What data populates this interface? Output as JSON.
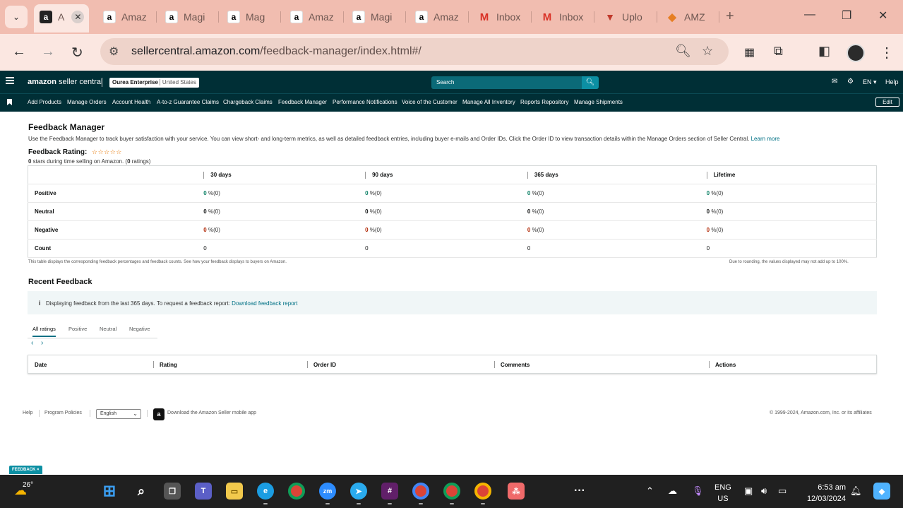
{
  "browser": {
    "tabs": [
      {
        "title": "A",
        "icon": "amazon-icon",
        "active": true
      },
      {
        "title": "Amaz",
        "icon": "amazon-icon"
      },
      {
        "title": "Magi",
        "icon": "amazon-icon"
      },
      {
        "title": "Mag",
        "icon": "amazon-icon"
      },
      {
        "title": "Amaz",
        "icon": "amazon-icon"
      },
      {
        "title": "Magi",
        "icon": "amazon-icon"
      },
      {
        "title": "Amaz",
        "icon": "amazon-icon"
      },
      {
        "title": "Inbox",
        "icon": "gmail-icon"
      },
      {
        "title": "Inbox",
        "icon": "gmail-icon"
      },
      {
        "title": "Uplo",
        "icon": "upload-icon"
      },
      {
        "title": "AMZ",
        "icon": "amz-icon"
      }
    ],
    "url_host": "sellercentral.amazon.com",
    "url_path": "/feedback-manager/index.html#/"
  },
  "header": {
    "logo_bold": "amazon",
    "logo_rest": " seller central",
    "store_name": "Ourea Enterprise",
    "marketplace": "United States",
    "search_placeholder": "Search",
    "lang": "EN",
    "help": "Help"
  },
  "nav": {
    "items": [
      "Add Products",
      "Manage Orders",
      "Account Health",
      "A-to-z Guarantee Claims",
      "Chargeback Claims",
      "Feedback Manager",
      "Performance Notifications",
      "Voice of the Customer",
      "Manage All Inventory",
      "Reports Repository",
      "Manage Shipments"
    ],
    "edit_label": "Edit"
  },
  "page": {
    "title": "Feedback Manager",
    "description": "Use the Feedback Manager to track buyer satisfaction with your service. You can view short- and long-term metrics, as well as detailed feedback entries, including buyer e-mails and Order IDs. Click the Order ID to view transaction details within the Manage Orders section of Seller Central.",
    "learn_more": "Learn more",
    "rating_label": "Feedback Rating:",
    "stars": "☆☆☆☆☆",
    "rating_stars_count": "0",
    "rating_text_mid": " stars during time selling on Amazon. (",
    "rating_count": "0",
    "rating_text_end": " ratings)"
  },
  "feedback_table": {
    "columns": [
      "30 days",
      "90 days",
      "365 days",
      "Lifetime"
    ],
    "pct_suffix": "%(0)",
    "rows": [
      {
        "label": "Positive",
        "values": [
          "0",
          "0",
          "0",
          "0"
        ]
      },
      {
        "label": "Neutral",
        "values": [
          "0",
          "0",
          "0",
          "0"
        ]
      },
      {
        "label": "Negative",
        "values": [
          "0",
          "0",
          "0",
          "0"
        ]
      },
      {
        "label": "Count",
        "values": [
          "0",
          "0",
          "0",
          "0"
        ]
      }
    ],
    "note_left_prefix": "This table displays the corresponding feedback percentages and feedback counts. ",
    "note_left_link": "See how your feedback displays to buyers on Amazon.",
    "note_right": "Due to rounding, the values displayed may not add up to 100%."
  },
  "recent": {
    "title": "Recent Feedback",
    "info_icon": "i",
    "info_text": "Displaying feedback from the last 365 days. To request a feedback report:",
    "info_link": "Download feedback report",
    "tabs": [
      "All ratings",
      "Positive",
      "Neutral",
      "Negative"
    ],
    "columns": [
      "Date",
      "Rating",
      "Order ID",
      "Comments",
      "Actions"
    ]
  },
  "footer": {
    "help": "Help",
    "program_policies": "Program Policies",
    "language": "English",
    "app_text": "Download the Amazon Seller mobile app",
    "copyright": "© 1999-2024, Amazon.com, Inc. or its affiliates",
    "feedback_tag": "FEEDBACK ×"
  },
  "taskbar": {
    "temperature": "26°",
    "lang_line1": "ENG",
    "lang_line2": "US",
    "time": "6:53 am",
    "date": "12/03/2024"
  },
  "colors": {
    "header_bg": "#002f36",
    "positive": "#067d62",
    "negative": "#b12704",
    "link": "#007185",
    "browser_tabbar": "#f1bdb0"
  }
}
